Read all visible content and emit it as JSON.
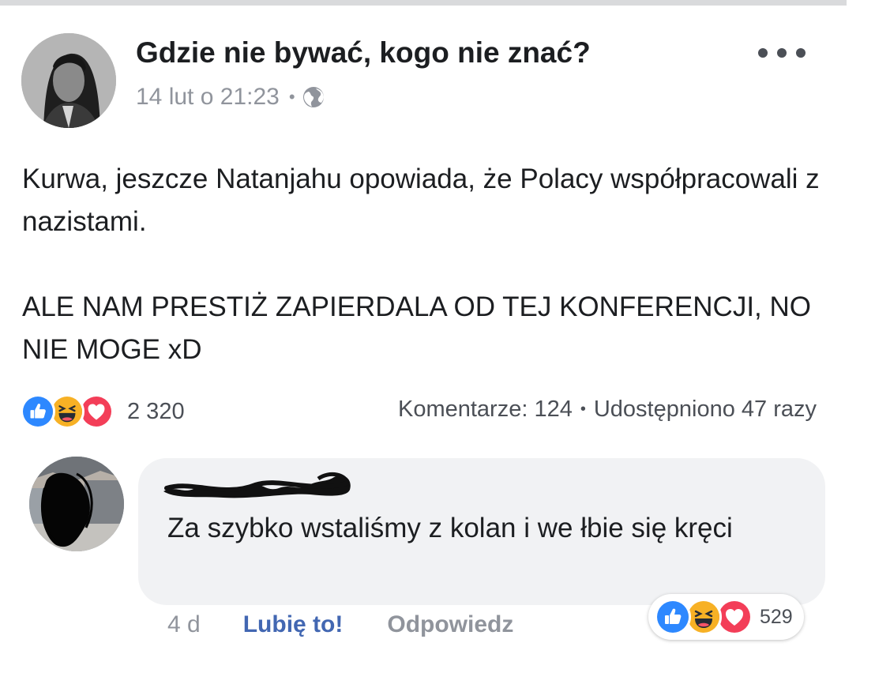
{
  "post": {
    "page_name": "Gdzie nie bywać, kogo nie znać?",
    "timestamp": "14 lut o 21:23",
    "meta_separator": "•",
    "privacy_icon": "globe-icon",
    "more_icon": "more-dots-icon",
    "text_paragraph_1": "Kurwa, jeszcze Natanjahu opowiada, że Polacy współpracowali z nazistami.",
    "text_paragraph_2": "ALE NAM PRESTIŻ ZAPIERDALA OD TEJ KONFERENCJI, NO NIE MOGE xD"
  },
  "reactions": {
    "types": [
      "like",
      "haha",
      "love"
    ],
    "count": "2 320"
  },
  "stats": {
    "comments": "Komentarze: 124",
    "separator": "•",
    "shares": "Udostępniono 47 razy"
  },
  "comment": {
    "text": "Za szybko wstaliśmy z kolan i we łbie się kręci",
    "time": "4 d",
    "like_label": "Lubię to!",
    "reply_label": "Odpowiedz",
    "reaction_types": [
      "like",
      "haha",
      "love"
    ],
    "reaction_count": "529"
  },
  "colors": {
    "link_blue": "#4267b2",
    "like_blue": "#2d88ff",
    "haha_yellow": "#f7b125",
    "love_red": "#f33e58",
    "secondary_text": "#90949c",
    "bubble_bg": "#f1f2f4"
  }
}
